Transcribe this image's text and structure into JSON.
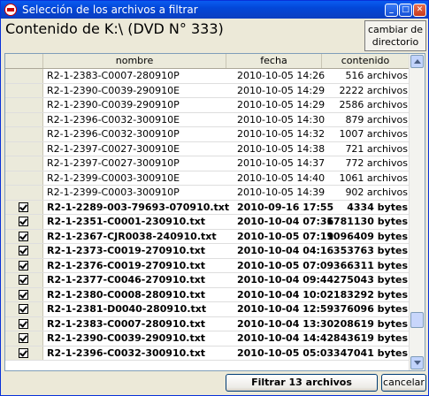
{
  "window": {
    "title": "Selección de los archivos a filtrar"
  },
  "header": {
    "contenido_label": "Contenido de K:\\ (DVD N° 333)",
    "cambiar_label": "cambiar de directorio"
  },
  "grid": {
    "columns": [
      "nombre",
      "fecha",
      "contenido"
    ],
    "rows": [
      {
        "checked": false,
        "bold": false,
        "nombre": "R2-1-2383-C0007-280910P",
        "fecha": "2010-10-05 14:26",
        "contenido": "516 archivos"
      },
      {
        "checked": false,
        "bold": false,
        "nombre": "R2-1-2390-C0039-290910E",
        "fecha": "2010-10-05 14:29",
        "contenido": "2222 archivos"
      },
      {
        "checked": false,
        "bold": false,
        "nombre": "R2-1-2390-C0039-290910P",
        "fecha": "2010-10-05 14:29",
        "contenido": "2586 archivos"
      },
      {
        "checked": false,
        "bold": false,
        "nombre": "R2-1-2396-C0032-300910E",
        "fecha": "2010-10-05 14:30",
        "contenido": "879 archivos"
      },
      {
        "checked": false,
        "bold": false,
        "nombre": "R2-1-2396-C0032-300910P",
        "fecha": "2010-10-05 14:32",
        "contenido": "1007 archivos"
      },
      {
        "checked": false,
        "bold": false,
        "nombre": "R2-1-2397-C0027-300910E",
        "fecha": "2010-10-05 14:38",
        "contenido": "721 archivos"
      },
      {
        "checked": false,
        "bold": false,
        "nombre": "R2-1-2397-C0027-300910P",
        "fecha": "2010-10-05 14:37",
        "contenido": "772 archivos"
      },
      {
        "checked": false,
        "bold": false,
        "nombre": "R2-1-2399-C0003-300910E",
        "fecha": "2010-10-05 14:40",
        "contenido": "1061 archivos"
      },
      {
        "checked": false,
        "bold": false,
        "nombre": "R2-1-2399-C0003-300910P",
        "fecha": "2010-10-05 14:39",
        "contenido": "902 archivos"
      },
      {
        "checked": true,
        "bold": true,
        "nombre": "R2-1-2289-003-79693-070910.txt",
        "fecha": "2010-09-16 17:55",
        "contenido": "4334 bytes"
      },
      {
        "checked": true,
        "bold": true,
        "nombre": "R2-1-2351-C0001-230910.txt",
        "fecha": "2010-10-04 07:36",
        "contenido": "1781130 bytes"
      },
      {
        "checked": true,
        "bold": true,
        "nombre": "R2-1-2367-CJR0038-240910.txt",
        "fecha": "2010-10-05 07:19",
        "contenido": "1096409 bytes"
      },
      {
        "checked": true,
        "bold": true,
        "nombre": "R2-1-2373-C0019-270910.txt",
        "fecha": "2010-10-04 04:16",
        "contenido": "353763 bytes"
      },
      {
        "checked": true,
        "bold": true,
        "nombre": "R2-1-2376-C0019-270910.txt",
        "fecha": "2010-10-05 07:09",
        "contenido": "366311 bytes"
      },
      {
        "checked": true,
        "bold": true,
        "nombre": "R2-1-2377-C0046-270910.txt",
        "fecha": "2010-10-04 09:44",
        "contenido": "275043 bytes"
      },
      {
        "checked": true,
        "bold": true,
        "nombre": "R2-1-2380-C0008-280910.txt",
        "fecha": "2010-10-04 10:02",
        "contenido": "183292 bytes"
      },
      {
        "checked": true,
        "bold": true,
        "nombre": "R2-1-2381-D0040-280910.txt",
        "fecha": "2010-10-04 12:59",
        "contenido": "376096 bytes"
      },
      {
        "checked": true,
        "bold": true,
        "nombre": "R2-1-2383-C0007-280910.txt",
        "fecha": "2010-10-04 13:30",
        "contenido": "208619 bytes"
      },
      {
        "checked": true,
        "bold": true,
        "nombre": "R2-1-2390-C0039-290910.txt",
        "fecha": "2010-10-04 14:42",
        "contenido": "843619 bytes"
      },
      {
        "checked": true,
        "bold": true,
        "nombre": "R2-1-2396-C0032-300910.txt",
        "fecha": "2010-10-05 05:03",
        "contenido": "347041 bytes"
      }
    ]
  },
  "footer": {
    "filtrar_label": "Filtrar 13 archivos",
    "cancelar_label": "cancelar"
  },
  "icons": [
    "app-icon",
    "minimize-icon",
    "maximize-icon",
    "close-icon",
    "checkbox-checked-icon",
    "scroll-up-icon",
    "scroll-down-icon"
  ]
}
